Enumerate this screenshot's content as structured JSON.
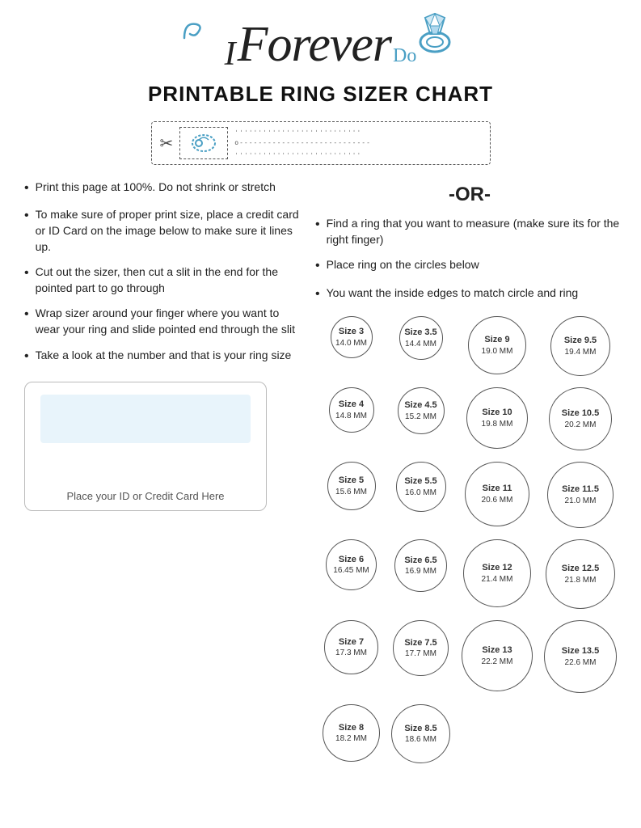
{
  "header": {
    "logo_i": "I",
    "logo_forever": "Forever",
    "logo_do": "Do"
  },
  "title": "PRINTABLE RING SIZER CHART",
  "sizer": {
    "tick_line1": "ˈˈˈˈˈˈˈˈˈˈˈˈˈˈˈˈˈˈˈˈˈˈˈˈˈˈˈ",
    "tick_line2": "o‐‐‐‐‐‐‐‐‐‐‐‐‐‐‐‐‐‐‐‐‐‐‐‐‐‐‐‐",
    "tick_line3": "ˌˌˌˌˌˌˌˌˌˌˌˌˌˌˌˌˌˌˌˌˌˌˌˌˌˌˌ"
  },
  "left_bullets": [
    "Print this page at 100%.  Do not shrink or stretch",
    "To make sure of proper print size, place a credit card or ID Card on the image below to make sure it lines up.",
    "Cut out the sizer, then cut a slit in the end for the pointed part to go through",
    "Wrap sizer around your finger where you want to wear your ring and slide pointed end through the slit",
    "Take a look at the number and that is your ring size"
  ],
  "or_text": "-OR-",
  "right_bullets": [
    "Find a ring that you want to measure (make sure its for the right finger)",
    "Place ring on the circles below",
    "You want the inside edges to match circle and ring"
  ],
  "card_label": "Place your ID or Credit Card Here",
  "rings": [
    {
      "label": "Size 3",
      "mm": "14.0 MM",
      "diam": 52
    },
    {
      "label": "Size 3.5",
      "mm": "14.4 MM",
      "diam": 54
    },
    {
      "label": "Size 9",
      "mm": "19.0 MM",
      "diam": 72
    },
    {
      "label": "Size 9.5",
      "mm": "19.4 MM",
      "diam": 74
    },
    {
      "label": "Size 4",
      "mm": "14.8 MM",
      "diam": 56
    },
    {
      "label": "Size 4.5",
      "mm": "15.2 MM",
      "diam": 58
    },
    {
      "label": "Size 10",
      "mm": "19.8 MM",
      "diam": 76
    },
    {
      "label": "Size 10.5",
      "mm": "20.2 MM",
      "diam": 78
    },
    {
      "label": "Size 5",
      "mm": "15.6 MM",
      "diam": 60
    },
    {
      "label": "Size 5.5",
      "mm": "16.0 MM",
      "diam": 62
    },
    {
      "label": "Size 11",
      "mm": "20.6 MM",
      "diam": 80
    },
    {
      "label": "Size 11.5",
      "mm": "21.0 MM",
      "diam": 82
    },
    {
      "label": "Size 6",
      "mm": "16.45 MM",
      "diam": 63
    },
    {
      "label": "Size 6.5",
      "mm": "16.9 MM",
      "diam": 65
    },
    {
      "label": "Size 12",
      "mm": "21.4 MM",
      "diam": 84
    },
    {
      "label": "Size 12.5",
      "mm": "21.8 MM",
      "diam": 86
    },
    {
      "label": "Size 7",
      "mm": "17.3 MM",
      "diam": 67
    },
    {
      "label": "Size 7.5",
      "mm": "17.7 MM",
      "diam": 69
    },
    {
      "label": "Size 13",
      "mm": "22.2 MM",
      "diam": 88
    },
    {
      "label": "Size 13.5",
      "mm": "22.6 MM",
      "diam": 90
    },
    {
      "label": "Size 8",
      "mm": "18.2 MM",
      "diam": 71
    },
    {
      "label": "Size 8.5",
      "mm": "18.6 MM",
      "diam": 73
    },
    {
      "label": "",
      "mm": "",
      "diam": 0
    },
    {
      "label": "",
      "mm": "",
      "diam": 0
    }
  ]
}
